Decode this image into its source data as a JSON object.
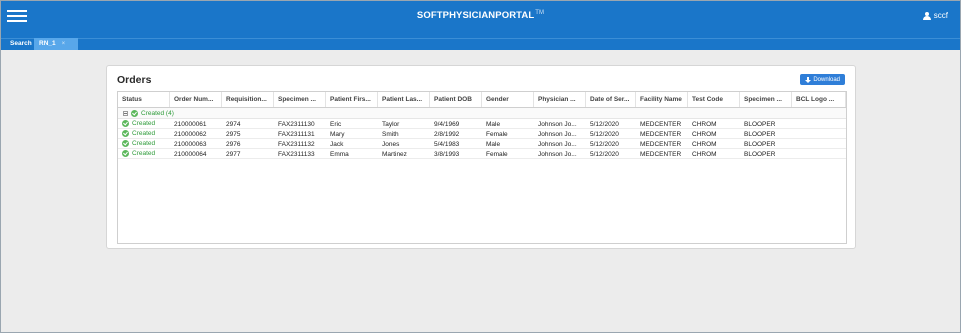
{
  "header": {
    "brand": "SOFTPHYSICIANPORTAL",
    "brand_mark": "TM",
    "user": "sccf"
  },
  "tabs": [
    {
      "label": "Search"
    },
    {
      "label": "RN_1",
      "close": "×"
    }
  ],
  "orders": {
    "title": "Orders",
    "download_label": "Download",
    "columns": [
      "Status",
      "Order Num...",
      "Requisition...",
      "Specimen ...",
      "Patient Firs...",
      "Patient Las...",
      "Patient DOB",
      "Gender",
      "Physician ...",
      "Date of Ser...",
      "Facility Name",
      "Test Code",
      "Specimen ...",
      "BCL Logo ..."
    ],
    "group": {
      "label": "Created (4)"
    },
    "rows": [
      [
        "Created",
        "210000061",
        "2974",
        "FAX2311130",
        "Eric",
        "Taylor",
        "9/4/1969",
        "Male",
        "Johnson Jo...",
        "5/12/2020",
        "MEDCENTER",
        "CHROM",
        "BLOOPER",
        ""
      ],
      [
        "Created",
        "210000062",
        "2975",
        "FAX2311131",
        "Mary",
        "Smith",
        "2/8/1992",
        "Female",
        "Johnson Jo...",
        "5/12/2020",
        "MEDCENTER",
        "CHROM",
        "BLOOPER",
        ""
      ],
      [
        "Created",
        "210000063",
        "2976",
        "FAX2311132",
        "Jack",
        "Jones",
        "5/4/1983",
        "Male",
        "Johnson Jo...",
        "5/12/2020",
        "MEDCENTER",
        "CHROM",
        "BLOOPER",
        ""
      ],
      [
        "Created",
        "210000064",
        "2977",
        "FAX2311133",
        "Emma",
        "Martinez",
        "3/8/1993",
        "Female",
        "Johnson Jo...",
        "5/12/2020",
        "MEDCENTER",
        "CHROM",
        "BLOOPER",
        ""
      ]
    ]
  },
  "icons": {
    "menu": "hamburger-icon",
    "user": "user-icon",
    "download": "download-icon",
    "status": "check-circle-icon",
    "collapse": "collapse-icon"
  },
  "colors": {
    "header_bg": "#1a76c9",
    "active_tab": "#58a7ea",
    "status_green": "#2e9b3a",
    "button_blue": "#2f7ed8",
    "content_bg": "#ececec"
  }
}
